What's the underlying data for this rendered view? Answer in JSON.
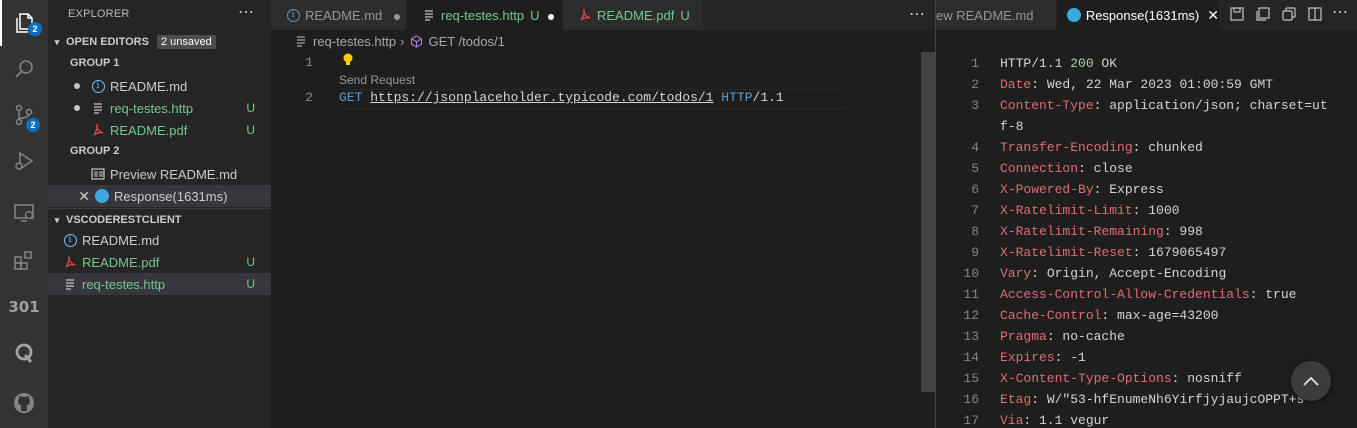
{
  "activity_bar": {
    "explorer_badge": "2",
    "scm_badge": "2",
    "redirect_label": "301"
  },
  "sidebar": {
    "title": "EXPLORER",
    "open_editors": {
      "title": "OPEN EDITORS",
      "unsaved": "2 unsaved",
      "group1": "GROUP 1",
      "group2": "GROUP 2",
      "items": [
        {
          "label": "README.md",
          "status": ""
        },
        {
          "label": "req-testes.http",
          "status": "U"
        },
        {
          "label": "README.pdf",
          "status": "U"
        },
        {
          "label": "Preview README.md",
          "status": ""
        },
        {
          "label": "Response(1631ms)",
          "status": ""
        }
      ]
    },
    "workspace": {
      "title": "VSCODERESTCLIENT",
      "items": [
        {
          "label": "README.md",
          "status": ""
        },
        {
          "label": "README.pdf",
          "status": "U"
        },
        {
          "label": "req-testes.http",
          "status": "U"
        }
      ]
    }
  },
  "editor1": {
    "tabs": [
      {
        "label": "README.md",
        "status": ""
      },
      {
        "label": "req-testes.http",
        "status": "U"
      },
      {
        "label": "README.pdf",
        "status": "U"
      }
    ],
    "breadcrumb": {
      "file": "req-testes.http",
      "symbol": "GET /todos/1"
    },
    "codelens": "Send Request",
    "lines": [
      {
        "n": "1"
      },
      {
        "n": "2",
        "method": "GET",
        "url": "https://jsonplaceholder.typicode.com/todos/1",
        "proto": "HTTP",
        "ver": "/1.1"
      }
    ]
  },
  "editor2": {
    "tabs": [
      {
        "label": "ew README.md"
      },
      {
        "label": "Response(1631ms)"
      }
    ],
    "response": [
      {
        "n": "1",
        "parts": [
          {
            "c": "",
            "v": "HTTP/1.1 "
          },
          {
            "c": "hnum",
            "v": "200"
          },
          {
            "c": "",
            "v": " OK"
          }
        ]
      },
      {
        "n": "2",
        "parts": [
          {
            "c": "hkey",
            "v": "Date"
          },
          {
            "c": "",
            "v": ": Wed, 22 Mar 2023 01:00:59 GMT"
          }
        ]
      },
      {
        "n": "3",
        "parts": [
          {
            "c": "hkey",
            "v": "Content-Type"
          },
          {
            "c": "",
            "v": ": application/json; charset=ut"
          }
        ]
      },
      {
        "n": "",
        "parts": [
          {
            "c": "",
            "v": "f-8"
          }
        ]
      },
      {
        "n": "4",
        "parts": [
          {
            "c": "hkey",
            "v": "Transfer-Encoding"
          },
          {
            "c": "",
            "v": ": chunked"
          }
        ]
      },
      {
        "n": "5",
        "parts": [
          {
            "c": "hkey",
            "v": "Connection"
          },
          {
            "c": "",
            "v": ": close"
          }
        ]
      },
      {
        "n": "6",
        "parts": [
          {
            "c": "hkey",
            "v": "X-Powered-By"
          },
          {
            "c": "",
            "v": ": Express"
          }
        ]
      },
      {
        "n": "7",
        "parts": [
          {
            "c": "hkey",
            "v": "X-Ratelimit-Limit"
          },
          {
            "c": "",
            "v": ": 1000"
          }
        ]
      },
      {
        "n": "8",
        "parts": [
          {
            "c": "hkey",
            "v": "X-Ratelimit-Remaining"
          },
          {
            "c": "",
            "v": ": 998"
          }
        ]
      },
      {
        "n": "9",
        "parts": [
          {
            "c": "hkey",
            "v": "X-Ratelimit-Reset"
          },
          {
            "c": "",
            "v": ": 1679065497"
          }
        ]
      },
      {
        "n": "10",
        "parts": [
          {
            "c": "hkey",
            "v": "Vary"
          },
          {
            "c": "",
            "v": ": Origin, Accept-Encoding"
          }
        ]
      },
      {
        "n": "11",
        "parts": [
          {
            "c": "hkey",
            "v": "Access-Control-Allow-Credentials"
          },
          {
            "c": "",
            "v": ": true"
          }
        ]
      },
      {
        "n": "12",
        "parts": [
          {
            "c": "hkey",
            "v": "Cache-Control"
          },
          {
            "c": "",
            "v": ": max-age=43200"
          }
        ]
      },
      {
        "n": "13",
        "parts": [
          {
            "c": "hkey",
            "v": "Pragma"
          },
          {
            "c": "",
            "v": ": no-cache"
          }
        ]
      },
      {
        "n": "14",
        "parts": [
          {
            "c": "hkey",
            "v": "Expires"
          },
          {
            "c": "",
            "v": ": -1"
          }
        ]
      },
      {
        "n": "15",
        "parts": [
          {
            "c": "hkey",
            "v": "X-Content-Type-Options"
          },
          {
            "c": "",
            "v": ": nosniff"
          }
        ]
      },
      {
        "n": "16",
        "parts": [
          {
            "c": "hkey",
            "v": "Etag"
          },
          {
            "c": "",
            "v": ": W/\"53-hfEnumeNh6YirfjyjaujcOPPT+s"
          }
        ]
      },
      {
        "n": "17",
        "parts": [
          {
            "c": "hkey",
            "v": "Via"
          },
          {
            "c": "",
            "v": ": 1.1 vegur"
          }
        ]
      }
    ]
  },
  "colors": {
    "activity_bg": "#333333",
    "sidebar_bg": "#252526",
    "editor_bg": "#1e1e1e",
    "untracked_green": "#73c991",
    "header_key": "#e06c75",
    "keyword_blue": "#569cd6",
    "badge_blue": "#0e70c0"
  }
}
